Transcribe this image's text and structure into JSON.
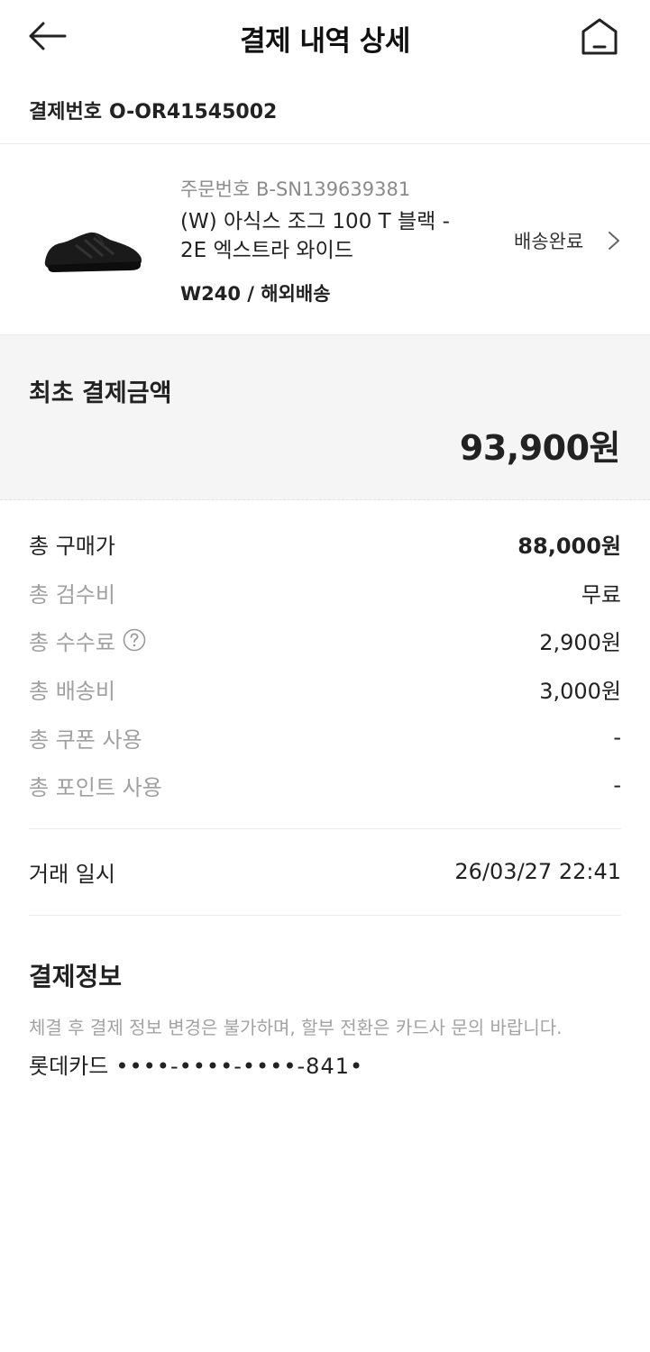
{
  "header": {
    "title": "결제 내역 상세",
    "back_icon": "arrow-left-icon",
    "home_icon": "home-icon"
  },
  "payment_number": {
    "label": "결제번호",
    "value": "O-OR41545002"
  },
  "product": {
    "order_number": "주문번호 B-SN139639381",
    "name": "(W) 아식스 조그 100 T 블랙 - 2E 엑스트라 와이드",
    "option": "W240 / 해외배송",
    "status": "배송완료",
    "image_icon": "black-sneaker-image"
  },
  "initial_payment": {
    "label": "최초 결제금액",
    "amount": "93,900원"
  },
  "breakdown": [
    {
      "label": "총 구매가",
      "value": "88,000원"
    },
    {
      "label": "총 검수비",
      "value": "무료"
    },
    {
      "label": "총 수수료",
      "value": "2,900원"
    },
    {
      "label": "총 배송비",
      "value": "3,000원"
    },
    {
      "label": "총 쿠폰 사용",
      "value": "-"
    },
    {
      "label": "총 포인트 사용",
      "value": "-"
    }
  ],
  "transaction": {
    "label": "거래 일시",
    "value": "26/03/27 22:41"
  },
  "payment_info": {
    "title": "결제정보",
    "note": "체결 후 결제 정보 변경은 불가하며, 할부 전환은 카드사 문의 바랍니다.",
    "card_name": "롯데카드",
    "card_number": "••••-••••-••••-841•"
  },
  "colors": {
    "primary_text": "#222222",
    "secondary_text": "#a0a0a0",
    "block_bg": "#f5f5f5"
  }
}
